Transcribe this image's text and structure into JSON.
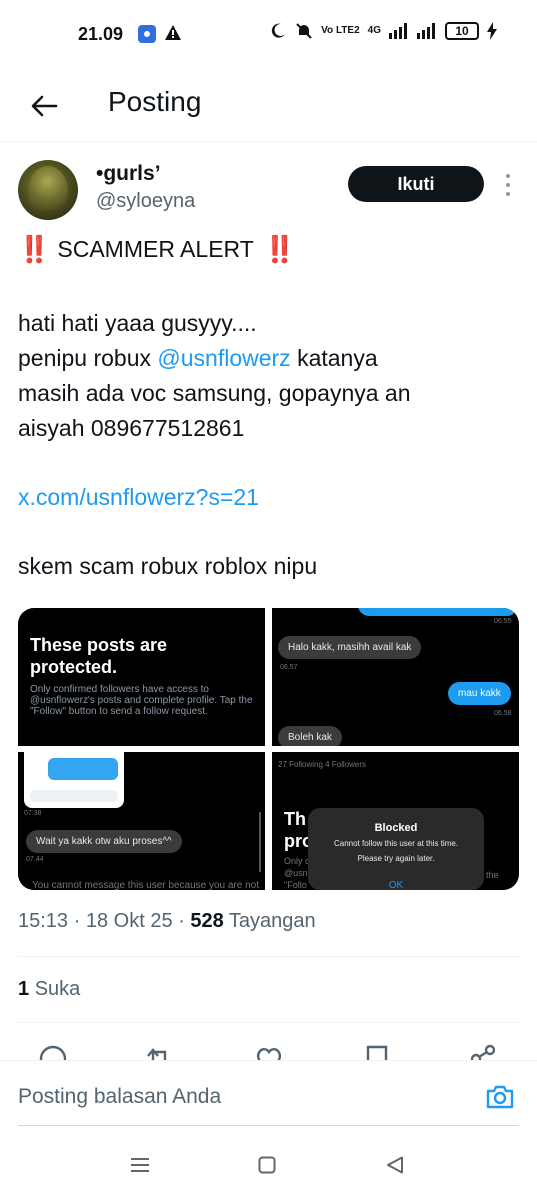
{
  "status_bar": {
    "time": "21.09",
    "battery": "10",
    "network": "4G",
    "volte": "Vo LTE2"
  },
  "header": {
    "title": "Posting"
  },
  "author": {
    "name": "•gurls’",
    "handle": "@syloeyna",
    "follow_label": "Ikuti"
  },
  "tweet": {
    "alert_emoji": "‼️",
    "alert": "SCAMMER ALERT",
    "line1": "hati hati yaaa gusyyy....",
    "line2_prefix": "penipu robux ",
    "mention": "@usnflowerz",
    "line2_suffix": " katanya",
    "line3": "masih ada voc samsung, gopaynya an",
    "line4": "aisyah 089677512861",
    "url": "x.com/usnflowerz?s=21",
    "line5": "skem scam robux roblox nipu"
  },
  "media": {
    "tile1": {
      "title": "These posts are protected.",
      "desc": "Only confirmed followers have access to @usnflowerz's posts and complete profile. Tap the \"Follow\" button to send a follow request."
    },
    "tile2": {
      "top_ts": "06.55",
      "msg1": "Halo kakk, masihh avail kak",
      "ts1": "06.57",
      "msg2": "mau kakk",
      "ts2": "06.58",
      "msg3": "Boleh kak"
    },
    "tile3": {
      "ts1": "07.38",
      "msg": "Wait ya kakk otw aku proses^^",
      "ts2": "07.44",
      "footer": "You cannot message this user because you are not"
    },
    "tile4": {
      "counts": "27 Following   4 Followers",
      "big": "Th\npro",
      "dialog_title": "Blocked",
      "dialog_msg1": "Cannot follow this user at this time.",
      "dialog_msg2": "Please try again later.",
      "dialog_ok": "OK"
    }
  },
  "meta": {
    "time": "15:13",
    "date": "18 Okt 25",
    "views": "528",
    "views_label": "Tayangan",
    "sep": " · "
  },
  "likes": {
    "count": "1",
    "label": "Suka"
  },
  "reply": {
    "placeholder": "Posting balasan Anda"
  },
  "colors": {
    "accent": "#1d9bf0",
    "text": "#0f1419",
    "muted": "#536471",
    "alert": "#e0245e"
  }
}
